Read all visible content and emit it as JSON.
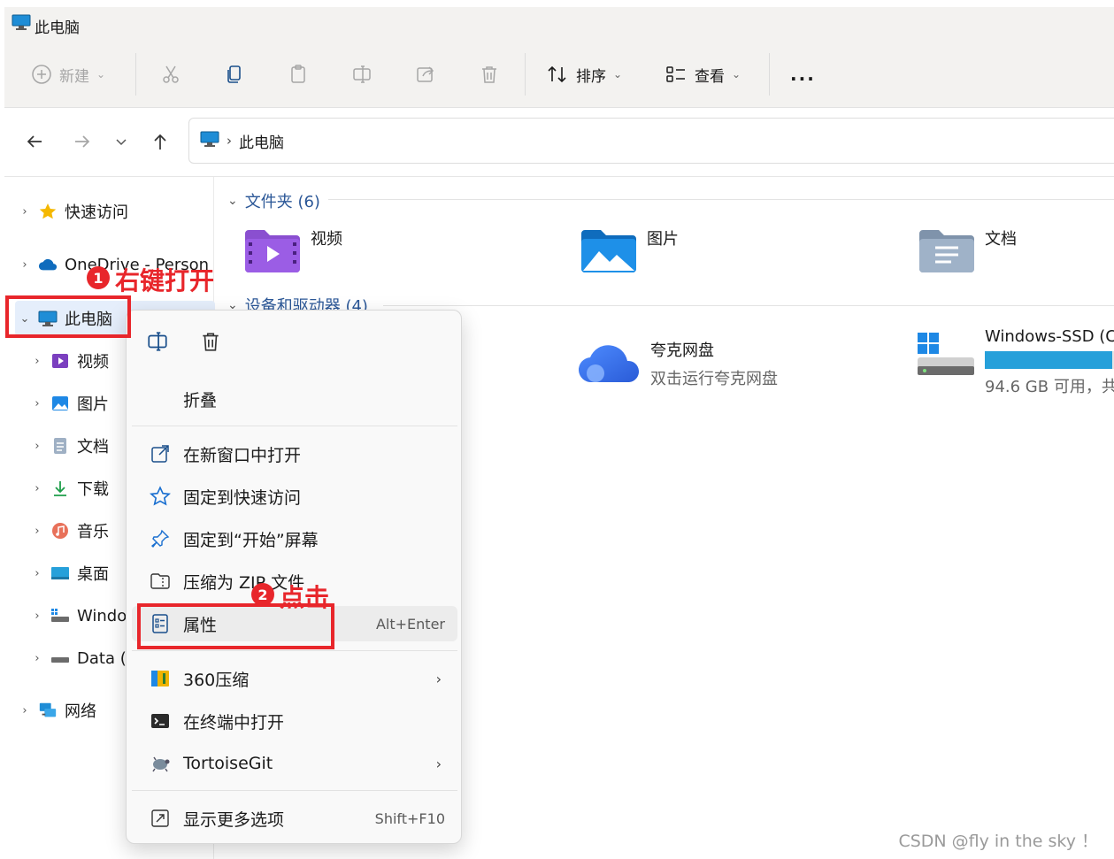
{
  "window": {
    "title": "此电脑"
  },
  "toolbar": {
    "new_label": "新建",
    "sort_label": "排序",
    "view_label": "查看",
    "more_label": "..."
  },
  "navbar": {
    "location_label": "此电脑"
  },
  "sidebar": {
    "items": [
      {
        "label": "快速访问"
      },
      {
        "label": "OneDrive - Person"
      },
      {
        "label": "此电脑"
      },
      {
        "label": "视频"
      },
      {
        "label": "图片"
      },
      {
        "label": "文档"
      },
      {
        "label": "下载"
      },
      {
        "label": "音乐"
      },
      {
        "label": "桌面"
      },
      {
        "label": "Windo"
      },
      {
        "label": "Data ("
      },
      {
        "label": "网络"
      }
    ]
  },
  "main": {
    "folders_group": "文件夹 (6)",
    "folders": [
      {
        "label": "视频"
      },
      {
        "label": "图片"
      },
      {
        "label": "文档"
      }
    ],
    "devices_group": "设备和驱动器 (4)",
    "devices": [
      {
        "label": "夸克网盘",
        "sublabel": "双击运行夸克网盘"
      },
      {
        "label": "Windows-SSD (C",
        "sublabel": "94.6 GB 可用，共",
        "usage_fraction": 0.9
      }
    ]
  },
  "context_menu": {
    "collapse": "折叠",
    "open_new_window": "在新窗口中打开",
    "pin_quick_access": "固定到快速访问",
    "pin_start": "固定到“开始”屏幕",
    "compress_zip": "压缩为 ZIP 文件",
    "properties": "属性",
    "properties_shortcut": "Alt+Enter",
    "compress_360": "360压缩",
    "open_terminal": "在终端中打开",
    "tortoisegit": "TortoiseGit",
    "show_more": "显示更多选项",
    "show_more_shortcut": "Shift+F10"
  },
  "annotations": {
    "step1_number": "1",
    "step1_text": "右键打开",
    "step2_number": "2",
    "step2_text": "点击"
  },
  "watermark": "CSDN @fly in the sky ！",
  "colors": {
    "annotation_red": "#e8262b",
    "drive_bar": "#26a0da",
    "selection": "#e5eefb"
  }
}
